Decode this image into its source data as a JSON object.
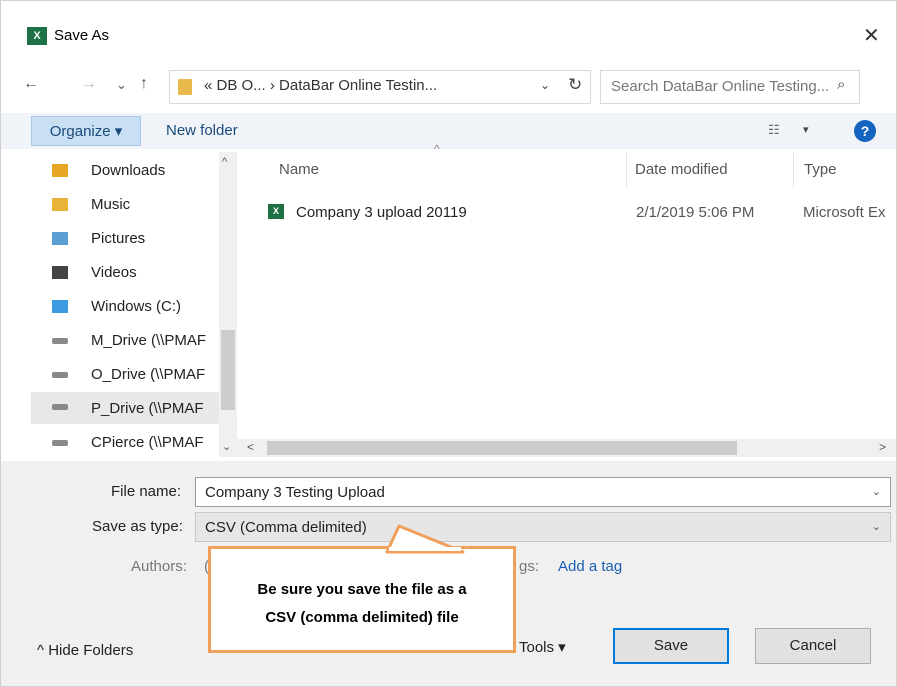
{
  "window": {
    "title": "Save As",
    "app_icon": "excel-icon",
    "close_symbol": "✕"
  },
  "nav": {
    "back": "←",
    "forward": "→",
    "recent": "⌄",
    "up": "↑",
    "breadcrumb": "« DB O...  ›  DataBar Online Testin...",
    "dropdown": "⌄",
    "refresh": "↻",
    "search_placeholder": "Search DataBar Online Testing...",
    "search_icon_char": "⌕"
  },
  "toolbar": {
    "organize": "Organize ▾",
    "new_folder": "New folder",
    "view_icon": "☷",
    "view_drop": "▾",
    "help": "?"
  },
  "sidebar": {
    "items": [
      {
        "label": "Downloads",
        "icon": "downloads-icon"
      },
      {
        "label": "Music",
        "icon": "music-icon"
      },
      {
        "label": "Pictures",
        "icon": "pictures-icon"
      },
      {
        "label": "Videos",
        "icon": "videos-icon"
      },
      {
        "label": "Windows (C:)",
        "icon": "windows-drive-icon"
      },
      {
        "label": "M_Drive (\\\\PMAF",
        "icon": "network-drive-icon"
      },
      {
        "label": "O_Drive (\\\\PMAF",
        "icon": "network-drive-icon"
      },
      {
        "label": "P_Drive (\\\\PMAF",
        "icon": "network-drive-icon",
        "selected": true
      },
      {
        "label": "CPierce (\\\\PMAF",
        "icon": "network-drive-icon"
      }
    ],
    "scroll_up": "^",
    "scroll_down": "⌄"
  },
  "files": {
    "columns": {
      "name": "Name",
      "date": "Date modified",
      "type": "Type"
    },
    "sort_arrow": "^",
    "rows": [
      {
        "name": "Company 3 upload 20119",
        "date": "2/1/2019 5:06 PM",
        "type": "Microsoft Ex"
      }
    ],
    "hscroll_left": "<",
    "hscroll_right": ">"
  },
  "form": {
    "file_name_label": "File name:",
    "file_name_value": "Company 3 Testing Upload",
    "save_type_label": "Save as type:",
    "save_type_value": "CSV (Comma delimited)",
    "authors_label": "Authors:",
    "authors_value_fragment": "(",
    "tags_label_fragment": "gs:",
    "add_tag": "Add a tag",
    "dropdown": "⌄"
  },
  "footer": {
    "hide_folders": "^  Hide Folders",
    "tools": "Tools  ▾",
    "save": "Save",
    "cancel": "Cancel"
  },
  "callout": {
    "line1": "Be sure you save the file as a",
    "line2": "CSV (comma delimited) file"
  },
  "colors": {
    "accent": "#0078d7",
    "callout_border": "#f0a05a",
    "excel_green": "#1e7145"
  }
}
